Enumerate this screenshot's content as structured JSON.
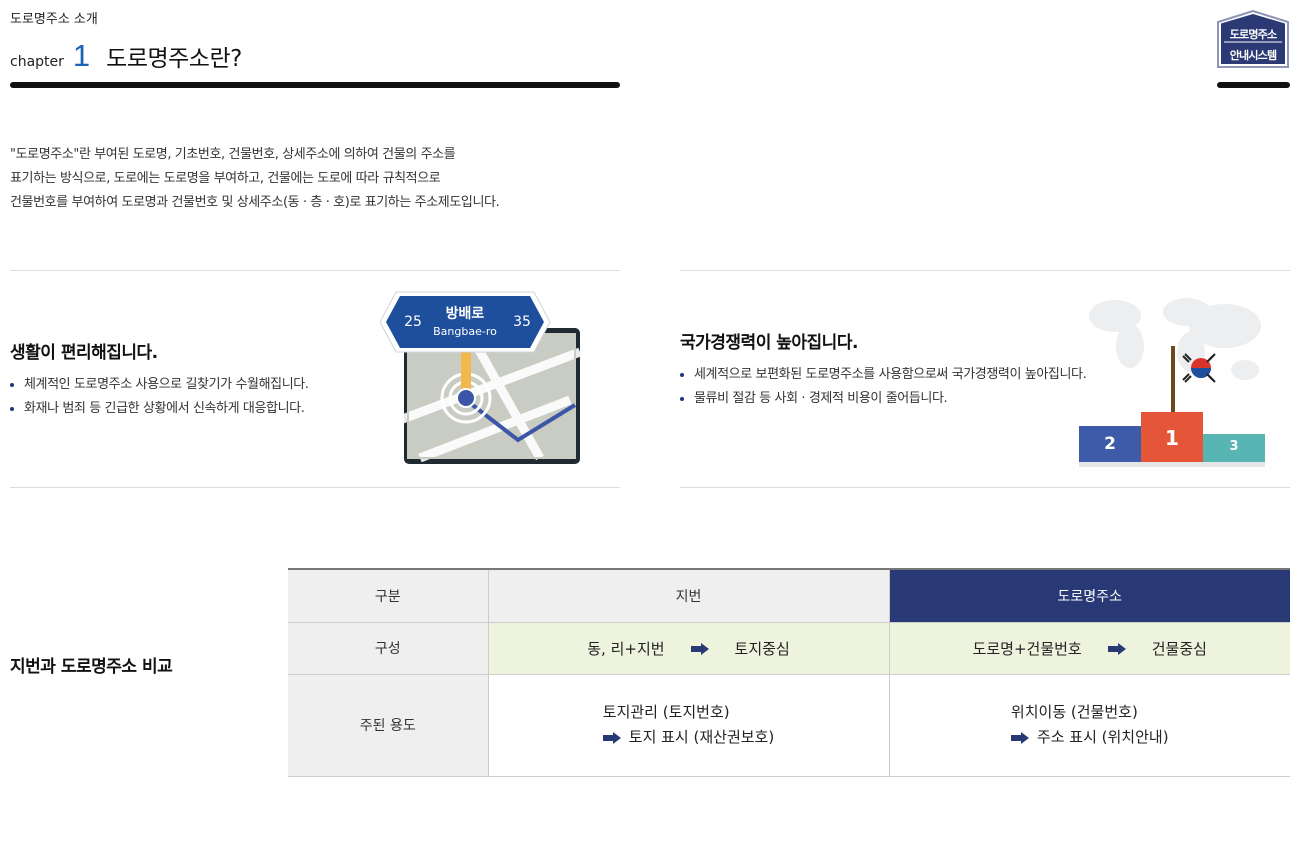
{
  "header": {
    "breadcrumb": "도로명주소 소개",
    "chapter_word": "chapter",
    "chapter_number": "1",
    "title": "도로명주소란?"
  },
  "badge": {
    "line1": "도로명주소",
    "line2": "안내시스템",
    "color": "#2b3a74"
  },
  "intro": {
    "lines": [
      "\"도로명주소\"란 부여된 도로명, 기초번호, 건물번호, 상세주소에 의하여 건물의 주소를",
      "표기하는 방식으로, 도로에는 도로명을 부여하고, 건물에는 도로에 따라 규칙적으로",
      "건물번호를 부여하여 도로명과 건물번호 및 상세주소(동  ·  층  ·  호)로 표기하는 주소제도입니다."
    ]
  },
  "benefits": [
    {
      "title": "생활이 편리해집니다.",
      "bullets": [
        "체계적인 도로명주소 사용으로 길찾기가 수월해집니다.",
        "화재나 범죄 등 긴급한 상황에서 신속하게 대응합니다."
      ],
      "sign": {
        "name_ko": "방배로",
        "name_en": "Bangbae-ro",
        "left_number": "25",
        "right_number": "35"
      }
    },
    {
      "title": "국가경쟁력이 높아집니다.",
      "bullets": [
        "세계적으로 보편화된 도로명주소를 사용함으로써 국가경쟁력이 높아집니다.",
        " 물류비 절감 등 사회  ·  경제적 비용이 줄어듭니다."
      ],
      "podium": {
        "first": "1",
        "second": "2",
        "third": "3"
      }
    }
  ],
  "comparison": {
    "title": "지번과 도로명주소 비교",
    "headers": [
      "구분",
      "지번",
      "도로명주소"
    ],
    "row_composition": {
      "label": "구성",
      "jibeon_left": "동, 리+지번",
      "jibeon_right": "토지중심",
      "road_left": "도로명+건물번호",
      "road_right": "건물중심"
    },
    "row_usage": {
      "label": "주된 용도",
      "jibeon_line1": "토지관리 (토지번호)",
      "jibeon_line2": "토지 표시 (재산권보호)",
      "road_line1": "위치이동 (건물번호)",
      "road_line2": "주소 표시 (위치안내)"
    }
  },
  "colors": {
    "accent_blue": "#1a63b8",
    "navy": "#283975",
    "highlight_row": "#eef3de"
  }
}
